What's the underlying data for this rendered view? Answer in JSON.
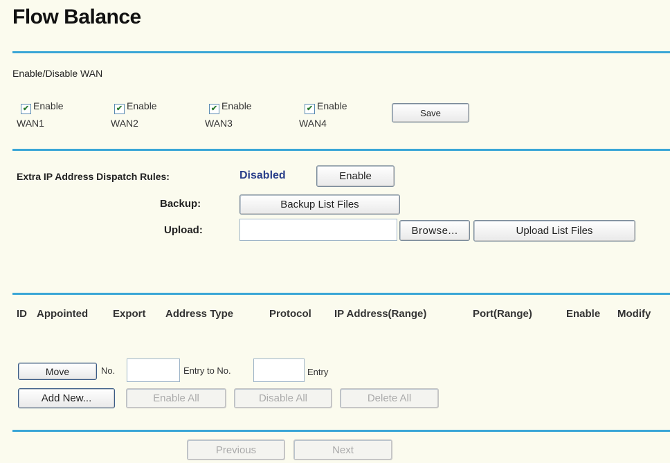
{
  "page": {
    "title": "Flow Balance"
  },
  "wan_section": {
    "heading": "Enable/Disable WAN",
    "items": [
      {
        "checkbox_label": "Enable",
        "wan_name": "WAN1",
        "checked": true
      },
      {
        "checkbox_label": "Enable",
        "wan_name": "WAN2",
        "checked": true
      },
      {
        "checkbox_label": "Enable",
        "wan_name": "WAN3",
        "checked": true
      },
      {
        "checkbox_label": "Enable",
        "wan_name": "WAN4",
        "checked": true
      }
    ],
    "save_label": "Save"
  },
  "dispatch": {
    "rules_label": "Extra IP Address Dispatch Rules:",
    "status": "Disabled",
    "enable_label": "Enable",
    "backup_label": "Backup:",
    "backup_button": "Backup List Files",
    "upload_label": "Upload:",
    "upload_value": "",
    "browse_button": "Browse...",
    "upload_button": "Upload List Files"
  },
  "table": {
    "columns": [
      "ID",
      "Appointed",
      "Export",
      "Address Type",
      "Protocol",
      "IP Address(Range)",
      "Port(Range)",
      "Enable",
      "Modify"
    ]
  },
  "move": {
    "button": "Move",
    "no_label": "No.",
    "from_value": "",
    "entry_to_label": "Entry to No.",
    "to_value": "",
    "entry_label": "Entry"
  },
  "actions": {
    "add_new": "Add New...",
    "enable_all": "Enable All",
    "disable_all": "Disable All",
    "delete_all": "Delete All"
  },
  "pagination": {
    "previous": "Previous",
    "next": "Next"
  },
  "colors": {
    "divider": "#3aa6d6",
    "status": "#2a3f8a",
    "background": "#fbfbee"
  }
}
